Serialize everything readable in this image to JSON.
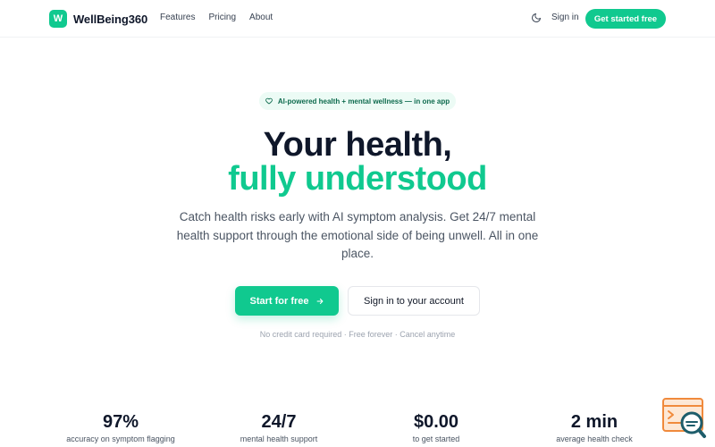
{
  "nav": {
    "logo_letter": "W",
    "brand": "WellBeing360",
    "links": [
      "Features",
      "Pricing",
      "About"
    ],
    "theme_icon": "moon-icon",
    "signin": "Sign in",
    "cta": "Get started free"
  },
  "hero": {
    "badge": "AI-powered health + mental wellness — in one app",
    "badge_icon": "heart-icon",
    "title_line1": "Your health,",
    "title_line2": "fully understood",
    "subtitle": "Catch health risks early with AI symptom analysis. Get 24/7 mental health support through the emotional side of being unwell. All in one place.",
    "primary_button": "Start for free",
    "primary_icon": "arrow-right-icon",
    "secondary_button": "Sign in to your account",
    "note": "No credit card required · Free forever · Cancel anytime"
  },
  "stats": [
    {
      "value": "97%",
      "label": "accuracy on symptom flagging"
    },
    {
      "value": "24/7",
      "label": "mental health support"
    },
    {
      "value": "$0.00",
      "label": "to get started"
    },
    {
      "value": "2 min",
      "label": "average health check"
    }
  ],
  "colors": {
    "accent": "#10c98f",
    "heading": "#0f172a",
    "badge_bg": "#ecfbf5",
    "widget_orange": "#f08a3c",
    "widget_teal": "#1e5d6b"
  },
  "widget": {
    "icon": "terminal-search-icon"
  }
}
